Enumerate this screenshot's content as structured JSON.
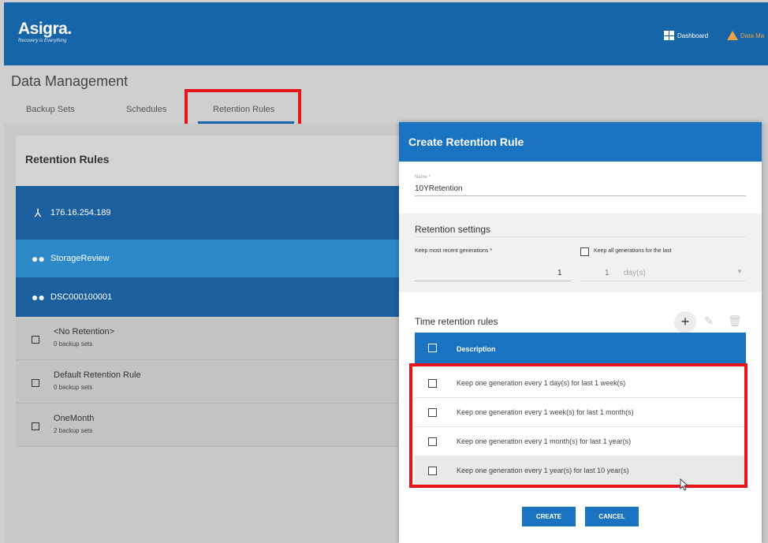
{
  "header": {
    "logo": "Asigra.",
    "tagline": "Recovery is Everything",
    "dashboard_label": "Dashboard",
    "data_mgmt_label": "Data Ma"
  },
  "page": {
    "title": "Data Management",
    "tabs": [
      {
        "label": "Backup Sets"
      },
      {
        "label": "Schedules"
      },
      {
        "label": "Retention Rules"
      }
    ]
  },
  "left_panel": {
    "title": "Retention Rules",
    "tree": [
      {
        "label": "176.16.254.189",
        "icon": "network-icon"
      },
      {
        "label": "StorageReview",
        "icon": "group-icon"
      },
      {
        "label": "DSC000100001",
        "icon": "users-icon"
      }
    ],
    "rules": [
      {
        "name": "<No Retention>",
        "count": "0 backup sets"
      },
      {
        "name": "Default Retention Rule",
        "count": "0 backup sets"
      },
      {
        "name": "OneMonth",
        "count": "2 backup sets"
      }
    ]
  },
  "dialog": {
    "title": "Create Retention Rule",
    "name_label": "Name *",
    "name_value": "10YRetention",
    "retention_settings_title": "Retention settings",
    "keep_recent_label": "Keep most recent generations *",
    "keep_recent_value": "1",
    "keep_all_label": "Keep all generations for the last",
    "keep_all_value": "1",
    "keep_all_unit": "day(s)",
    "time_rules_title": "Time retention rules",
    "table_header": "Description",
    "rows": [
      {
        "text": "Keep one generation every 1 day(s) for last 1 week(s)"
      },
      {
        "text": "Keep one generation every 1 week(s) for last 1 month(s)"
      },
      {
        "text": "Keep one generation every 1 month(s) for last 1 year(s)"
      },
      {
        "text": "Keep one generation every 1 year(s) for last 10 year(s)"
      }
    ],
    "create_label": "CREATE",
    "cancel_label": "CANCEL"
  },
  "colors": {
    "header": "#1565a8",
    "dialog_header": "#1a73c0",
    "highlight": "#e8151b"
  }
}
